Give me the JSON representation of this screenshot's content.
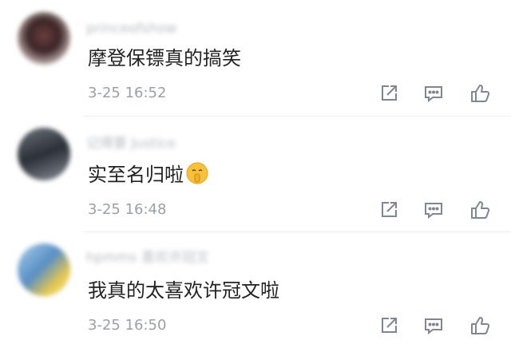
{
  "comments": [
    {
      "username": "princeofshow",
      "text": "摩登保镖真的搞笑",
      "time": "3-25 16:52",
      "emoji": ""
    },
    {
      "username": "记得要 Justice",
      "text": "实至名归啦",
      "time": "3-25 16:48",
      "emoji": "shush-face-emoji"
    },
    {
      "username": "hpmms 喜欢许冠文",
      "text": "我真的太喜欢许冠文啦",
      "time": "3-25 16:50",
      "emoji": ""
    }
  ],
  "icons": {
    "share": "share-icon",
    "comment": "comment-icon",
    "like": "thumbs-up-icon"
  },
  "colors": {
    "text": "#222222",
    "meta": "#9aa0a6",
    "icon": "#7f8790",
    "divider": "#eeeeee"
  }
}
